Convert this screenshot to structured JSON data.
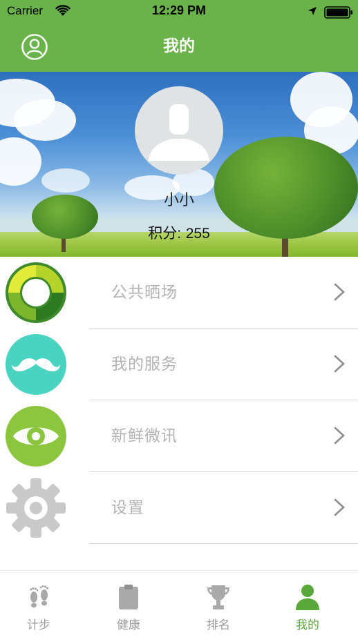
{
  "status_bar": {
    "carrier": "Carrier",
    "time": "12:29 PM"
  },
  "nav": {
    "title": "我的"
  },
  "profile": {
    "name": "小小",
    "points_label": "积分:",
    "points_value": "255"
  },
  "menu": [
    {
      "label": "公共晒场",
      "icon": "refresh-circle-icon"
    },
    {
      "label": "我的服务",
      "icon": "mustache-icon"
    },
    {
      "label": "新鲜微讯",
      "icon": "eye-icon"
    },
    {
      "label": "设置",
      "icon": "gear-icon"
    }
  ],
  "tabs": [
    {
      "label": "计步",
      "icon": "footprints-icon",
      "active": false
    },
    {
      "label": "健康",
      "icon": "clipboard-icon",
      "active": false
    },
    {
      "label": "排名",
      "icon": "trophy-icon",
      "active": false
    },
    {
      "label": "我的",
      "icon": "person-icon",
      "active": true
    }
  ],
  "colors": {
    "brand_green": "#6ab34a",
    "active_tab": "#5aa83a",
    "menu_text": "#b3b3b3"
  }
}
